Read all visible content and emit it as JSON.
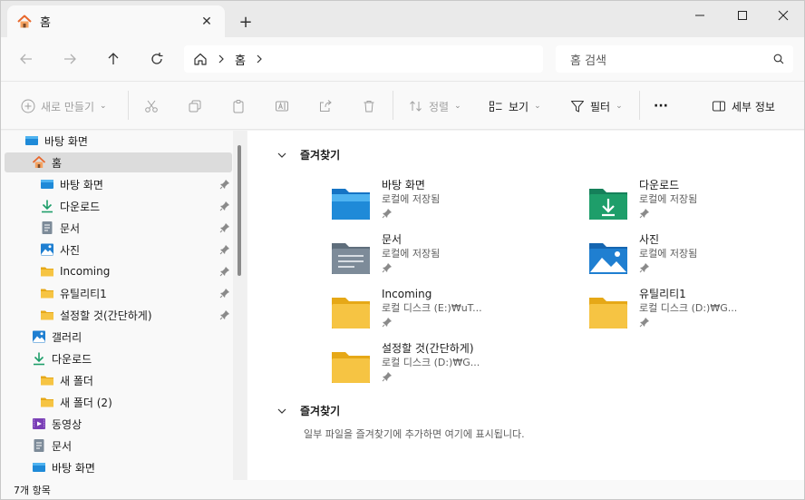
{
  "window": {
    "tab_title": "홈",
    "new_tab": "+",
    "minimize": "—",
    "maximize": "□",
    "close": "✕"
  },
  "address": {
    "crumbs": [
      "홈"
    ],
    "search_placeholder": "홈 검색"
  },
  "commands": {
    "new": "새로 만들기",
    "sort": "정렬",
    "view": "보기",
    "filter": "필터",
    "more": "···",
    "details": "세부 정보"
  },
  "sidebar": {
    "items": [
      {
        "label": "바탕 화면",
        "icon": "desktop-icon"
      },
      {
        "label": "홈",
        "icon": "home-icon"
      },
      {
        "label": "바탕 화면",
        "icon": "desktop-icon"
      },
      {
        "label": "다운로드",
        "icon": "download-icon"
      },
      {
        "label": "문서",
        "icon": "document-icon"
      },
      {
        "label": "사진",
        "icon": "pictures-icon"
      },
      {
        "label": "Incoming",
        "icon": "folder-icon"
      },
      {
        "label": "유틸리티1",
        "icon": "folder-icon"
      },
      {
        "label": "설정할 것(간단하게)",
        "icon": "folder-icon"
      },
      {
        "label": "갤러리",
        "icon": "gallery-icon"
      },
      {
        "label": "다운로드",
        "icon": "download-icon"
      },
      {
        "label": "새 폴더",
        "icon": "folder-icon"
      },
      {
        "label": "새 폴더 (2)",
        "icon": "folder-icon"
      },
      {
        "label": "동영상",
        "icon": "video-icon"
      },
      {
        "label": "문서",
        "icon": "document-icon"
      },
      {
        "label": "바탕 화면",
        "icon": "desktop-icon"
      }
    ]
  },
  "main": {
    "section1_title": "즐겨찾기",
    "section2_title": "즐겨찾기",
    "empty_message": "일부 파일을 즐겨찾기에 추가하면 여기에 표시됩니다.",
    "tiles": [
      {
        "name": "바탕 화면",
        "sub": "로컬에 저장됨",
        "icon": "desktop-folder-icon"
      },
      {
        "name": "다운로드",
        "sub": "로컬에 저장됨",
        "icon": "download-folder-icon"
      },
      {
        "name": "문서",
        "sub": "로컬에 저장됨",
        "icon": "documents-folder-icon"
      },
      {
        "name": "사진",
        "sub": "로컬에 저장됨",
        "icon": "pictures-folder-icon"
      },
      {
        "name": "Incoming",
        "sub": "로컬 디스크 (E:)₩uT...",
        "icon": "folder-icon"
      },
      {
        "name": "유틸리티1",
        "sub": "로컬 디스크 (D:)₩G...",
        "icon": "folder-icon"
      },
      {
        "name": "설정할 것(간단하게)",
        "sub": "로컬 디스크 (D:)₩G...",
        "icon": "folder-icon"
      }
    ]
  },
  "status": {
    "item_count": "7개 항목"
  },
  "colors": {
    "folder_yellow": "#f6c443",
    "folder_blue": "#1f8ad8",
    "download_green": "#1e9e6a",
    "home_orange": "#e8672b"
  }
}
